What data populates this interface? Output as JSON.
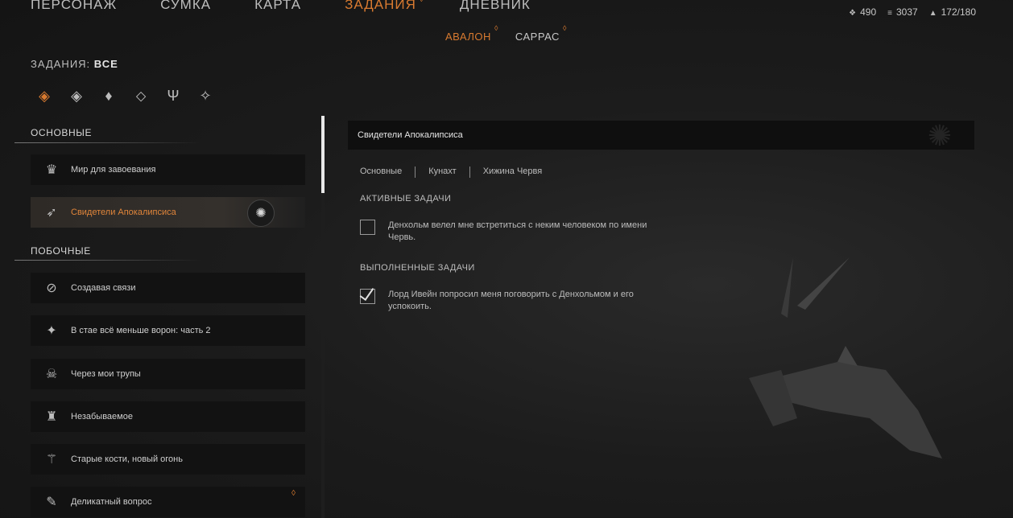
{
  "nav": {
    "tabs": [
      {
        "label": "ПЕРСОНАЖ",
        "active": false
      },
      {
        "label": "СУМКА",
        "active": false
      },
      {
        "label": "КАРТА",
        "active": false
      },
      {
        "label": "ЗАДАНИЯ",
        "active": true
      },
      {
        "label": "ДНЕВНИК",
        "active": false
      }
    ],
    "stats": {
      "souls": "490",
      "currency": "3037",
      "carry": "172/180"
    },
    "subtabs": [
      {
        "label": "АВАЛОН",
        "active": true
      },
      {
        "label": "САРРАС",
        "active": false
      }
    ]
  },
  "filter": {
    "prefix": "ЗАДАНИЯ:",
    "value": "ВСЕ"
  },
  "sections": {
    "main": "ОСНОВНЫЕ",
    "side": "ПОБОЧНЫЕ"
  },
  "main_quests": [
    {
      "label": "Мир для завоевания"
    },
    {
      "label": "Свидетели Апокалипсиса"
    }
  ],
  "side_quests": [
    {
      "label": "Создавая связи"
    },
    {
      "label": "В стае всё меньше ворон: часть 2"
    },
    {
      "label": "Через мои трупы"
    },
    {
      "label": "Незабываемое"
    },
    {
      "label": "Старые кости, новый огонь"
    },
    {
      "label": "Деликатный вопрос"
    }
  ],
  "detail": {
    "title": "Свидетели Апокалипсиса",
    "locations": [
      "Основные",
      "Кунахт",
      "Хижина Червя"
    ],
    "active_header": "АКТИВНЫЕ ЗАДАЧИ",
    "active_task": "Денхольм велел мне встретиться с неким человеком по имени Червь.",
    "done_header": "ВЫПОЛНЕННЫЕ ЗАДАЧИ",
    "done_task": "Лорд Ивейн попросил меня поговорить с Денхольмом и его успокоить."
  },
  "colors": {
    "accent": "#d87a30",
    "background": "#1c1c1c"
  }
}
